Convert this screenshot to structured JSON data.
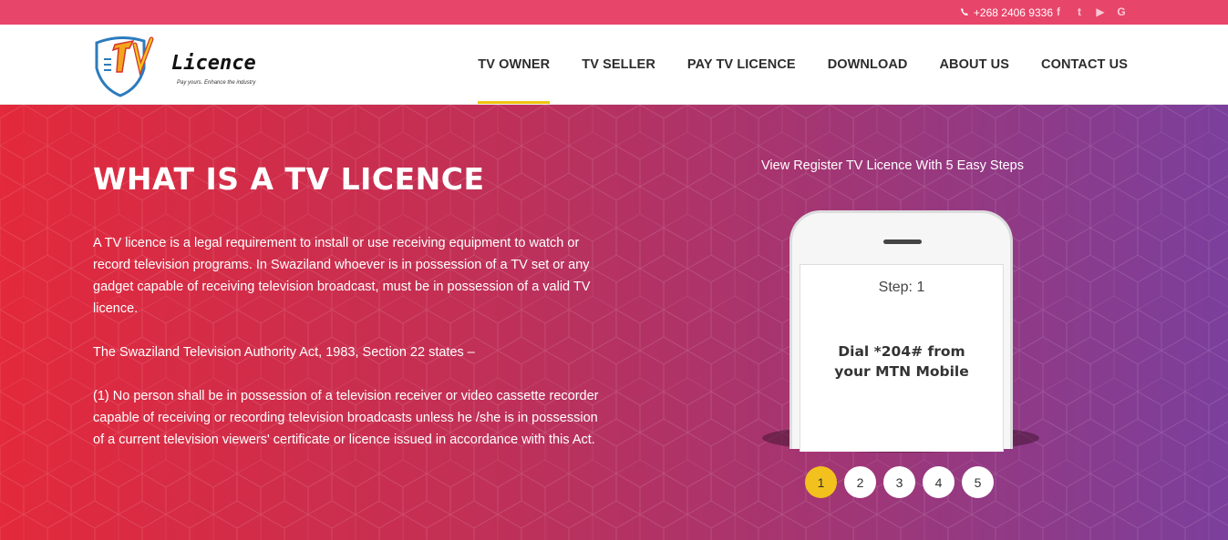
{
  "topbar": {
    "phone": "+268 2406 9336",
    "socials": [
      {
        "name": "facebook-icon",
        "glyph": "f"
      },
      {
        "name": "twitter-icon",
        "glyph": "t"
      },
      {
        "name": "youtube-icon",
        "glyph": "▶"
      },
      {
        "name": "google-icon",
        "glyph": "G"
      }
    ]
  },
  "logo": {
    "word": "Licence",
    "tagline": "Pay yours. Enhance the industry"
  },
  "nav": [
    {
      "label": "TV OWNER",
      "active": true
    },
    {
      "label": "TV SELLER"
    },
    {
      "label": "PAY TV LICENCE"
    },
    {
      "label": "DOWNLOAD"
    },
    {
      "label": "ABOUT US"
    },
    {
      "label": "CONTACT US"
    }
  ],
  "hero": {
    "title": "WHAT IS A TV LICENCE",
    "paragraphs": [
      "A TV licence is a legal requirement to install or use receiving equipment to watch or record television programs. In Swaziland whoever is in possession of a TV set or any gadget capable of receiving television broadcast, must be in possession of a valid TV licence.",
      "The Swaziland Television Authority Act, 1983, Section 22 states –",
      "(1) No person shall be in possession of a television receiver or video cassette recorder capable of receiving or recording television broadcasts unless he /she is in possession of a current television viewers' certificate or licence issued in accordance with this Act."
    ],
    "steps_link": "View Register TV Licence With 5 Easy Steps",
    "phone_screen": {
      "step": "Step: 1",
      "instruction": "Dial *204# from your MTN Mobile"
    },
    "pager": [
      "1",
      "2",
      "3",
      "4",
      "5"
    ]
  },
  "colors": {
    "topbar": "#e8456a",
    "accent": "#f1c40f",
    "hero_start": "#e3293b",
    "hero_end": "#7b3f9c"
  }
}
